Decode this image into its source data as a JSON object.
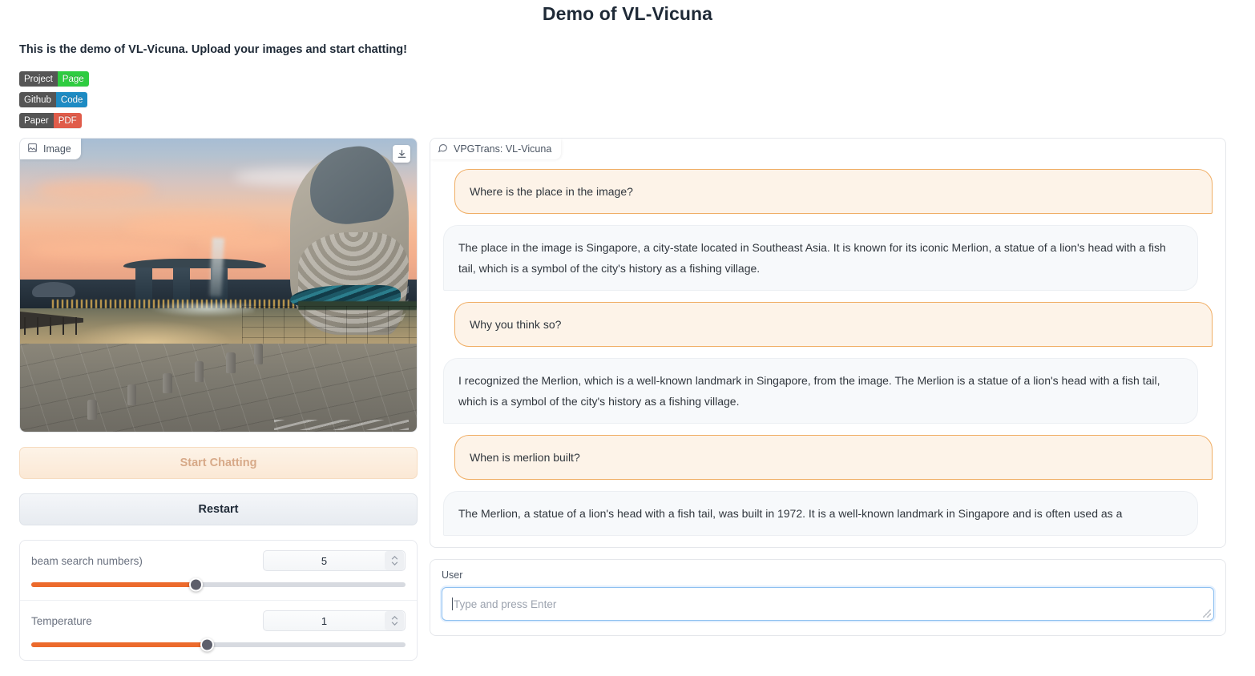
{
  "app": {
    "title": "Demo of VL-Vicuna",
    "intro": "This is the demo of VL-Vicuna. Upload your images and start chatting!"
  },
  "badges": [
    {
      "left": "Project",
      "right": "Page",
      "right_color": "#2ecc40"
    },
    {
      "left": "Github",
      "right": "Code",
      "right_color": "#1e8bc3"
    },
    {
      "left": "Paper",
      "right": "PDF",
      "right_color": "#e05c4a"
    }
  ],
  "image_panel": {
    "tab_label": "Image",
    "tab_icon": "image-icon",
    "download_icon": "download-icon"
  },
  "buttons": {
    "start_chatting": "Start Chatting",
    "restart": "Restart"
  },
  "sliders": [
    {
      "label": "beam search numbers)",
      "value": "5",
      "fill_percent": 44
    },
    {
      "label": "Temperature",
      "value": "1",
      "fill_percent": 47
    }
  ],
  "chat": {
    "tab_label": "VPGTrans: VL-Vicuna",
    "tab_icon": "chat-bubble-icon",
    "messages": [
      {
        "role": "user",
        "text": "Where is the place in the image?"
      },
      {
        "role": "bot",
        "text": "The place in the image is Singapore, a city-state located in Southeast Asia. It is known for its iconic Merlion, a statue of a lion's head with a fish tail, which is a symbol of the city's history as a fishing village."
      },
      {
        "role": "user",
        "text": "Why you think so?"
      },
      {
        "role": "bot",
        "text": "I recognized the Merlion, which is a well-known landmark in Singapore, from the image. The Merlion is a statue of a lion's head with a fish tail, which is a symbol of the city's history as a fishing village."
      },
      {
        "role": "user",
        "text": "When is merlion built?"
      },
      {
        "role": "bot",
        "text": "The Merlion, a statue of a lion's head with a fish tail, was built in 1972. It is a well-known landmark in Singapore and is often used as a"
      }
    ]
  },
  "user_input": {
    "label": "User",
    "placeholder": "Type and press Enter",
    "value": ""
  },
  "colors": {
    "accent_orange": "#ec6a2c",
    "user_bubble_bg": "#fdf3e8",
    "user_bubble_border": "#f0ae65",
    "bot_bubble_bg": "#f7f9fb",
    "focus_blue": "#8ec0f0"
  }
}
